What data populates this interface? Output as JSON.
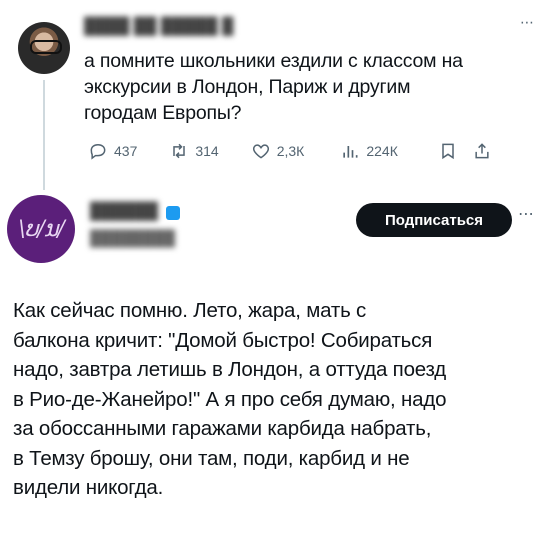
{
  "tweet1": {
    "author_name": "████ ██ █████ █",
    "text": "а помните школьники ездили с классом на\nэкскурсии в Лондон, Париж и другим\nгородам Европы?",
    "stats": {
      "replies": "437",
      "retweets": "314",
      "likes": "2,3К",
      "views": "224К"
    }
  },
  "tweet2": {
    "avatar_text": "\\ບ/ນ/",
    "author_name": "██████",
    "handle": "████████",
    "subscribe_label": "Подписаться",
    "text": "Как сейчас помню. Лето, жара, мать с\nбалкона кричит: \"Домой быстро! Собираться\nнадо, завтра летишь в Лондон, а оттуда поезд\nв Рио-де-Жанейро!\" А я про себя думаю, надо\nза обоссанными гаражами карбида набрать,\nв Темзу брошу, они там, поди, карбид и не\nвидели никогда."
  },
  "icons": [
    "reply-icon",
    "retweet-icon",
    "like-icon",
    "views-icon",
    "bookmark-icon",
    "share-icon",
    "more-icon"
  ],
  "colors": {
    "text": "#0f1419",
    "muted": "#536471",
    "button_bg": "#0f1419",
    "avatar2_bg": "#5b1f7a",
    "verified": "#1d9bf0"
  }
}
